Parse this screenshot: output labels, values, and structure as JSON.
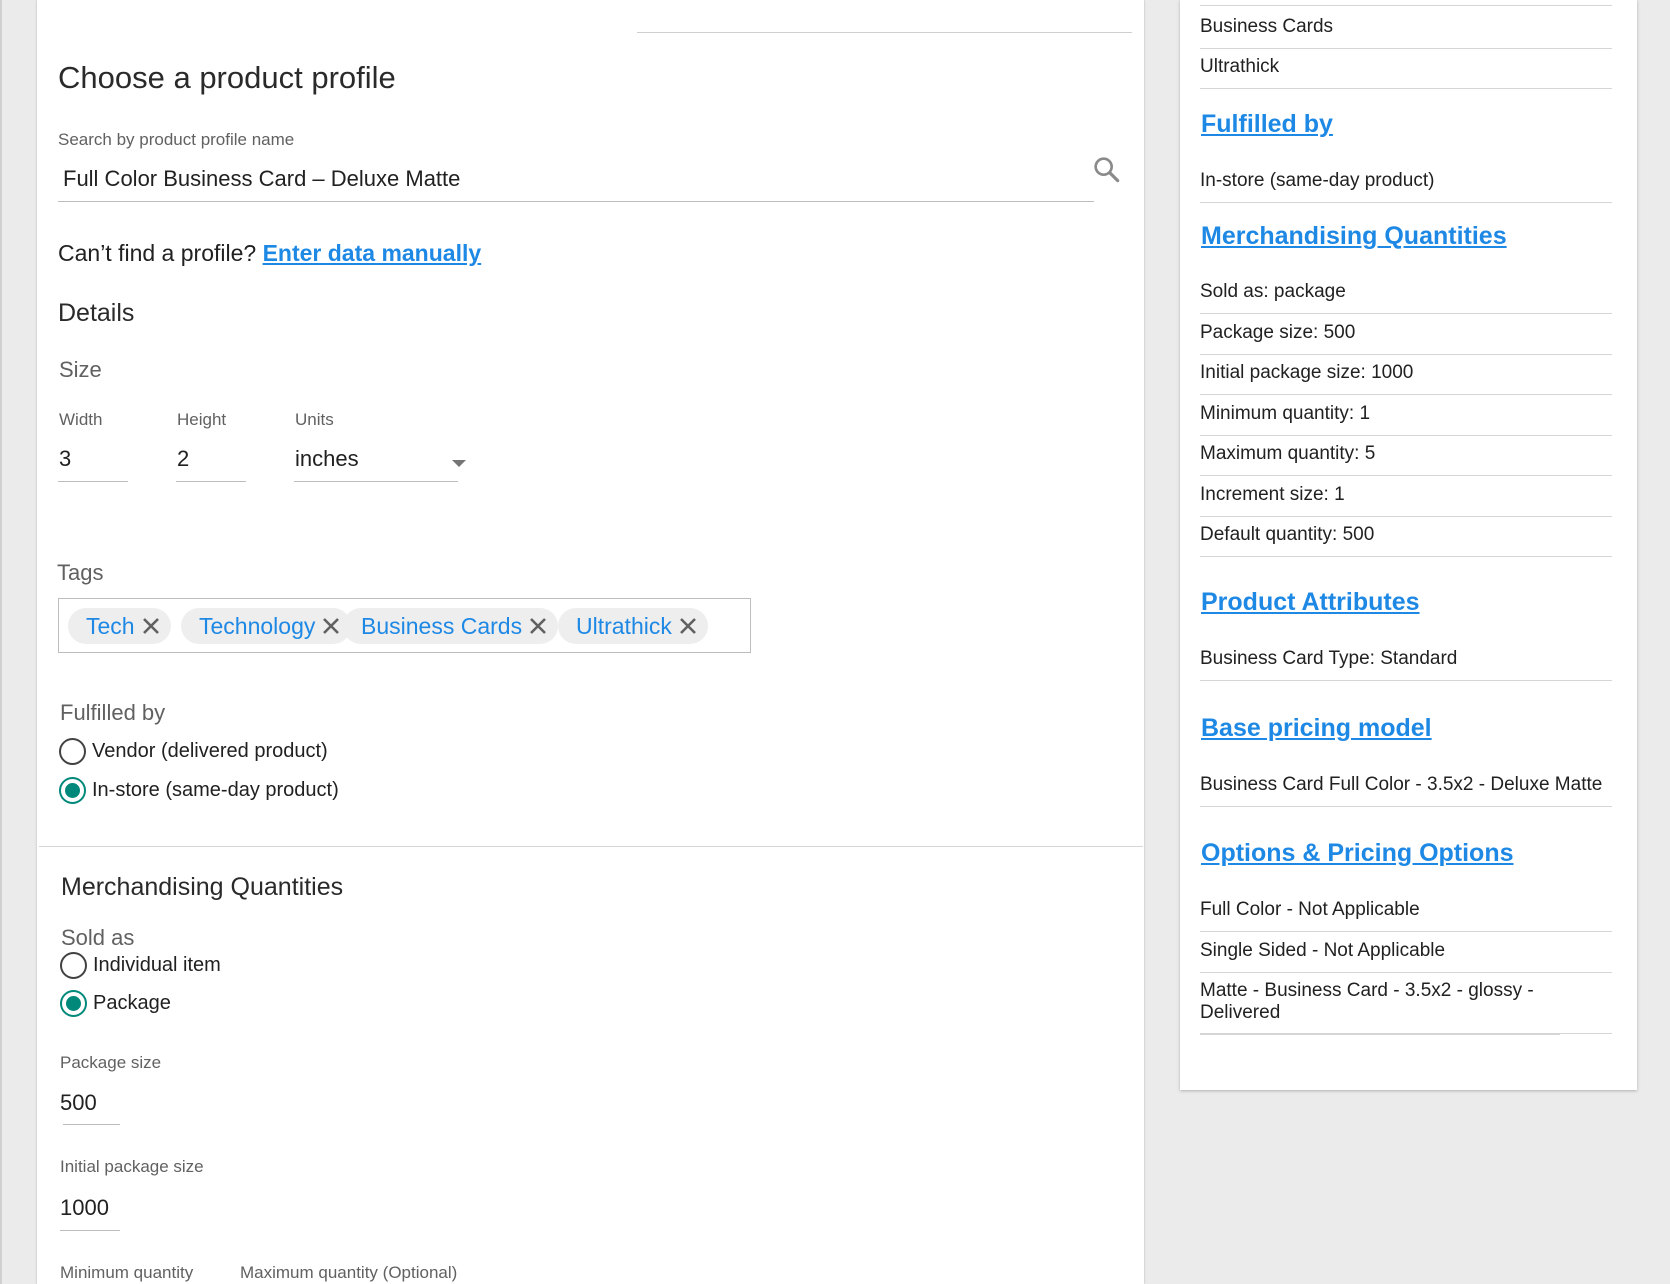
{
  "main": {
    "heading": "Choose a product profile",
    "search": {
      "label": "Search by product profile name",
      "value": "Full Color Business Card – Deluxe Matte",
      "icon": "search-icon"
    },
    "cant_find": {
      "text": "Can’t find a profile?",
      "link": "Enter data manually"
    },
    "details": {
      "title": "Details",
      "size_label": "Size",
      "width": {
        "label": "Width",
        "value": "3"
      },
      "height": {
        "label": "Height",
        "value": "2"
      },
      "units": {
        "label": "Units",
        "value": "inches"
      }
    },
    "tags": {
      "label": "Tags",
      "items": [
        "Tech",
        "Technology",
        "Business Cards",
        "Ultrathick"
      ]
    },
    "fulfilled": {
      "label": "Fulfilled by",
      "options": [
        {
          "label": "Vendor (delivered product)",
          "selected": false
        },
        {
          "label": "In-store (same-day product)",
          "selected": true
        }
      ]
    },
    "merch": {
      "title": "Merchandising Quantities",
      "sold_as_label": "Sold as",
      "options": [
        {
          "label": "Individual item",
          "selected": false
        },
        {
          "label": "Package",
          "selected": true
        }
      ],
      "package_size": {
        "label": "Package size",
        "value": "500"
      },
      "initial_package_size": {
        "label": "Initial package size",
        "value": "1000"
      },
      "minimum_quantity_label": "Minimum quantity",
      "maximum_quantity_label": "Maximum quantity (Optional)"
    }
  },
  "summary": {
    "tags_rows": [
      "Business Cards",
      "Ultrathick"
    ],
    "fulfilled_head": "Fulfilled by",
    "fulfilled_rows": [
      "In-store (same-day product)"
    ],
    "merch_head": "Merchandising Quantities",
    "merch_rows": [
      "Sold as: package",
      "Package size: 500",
      "Initial package size: 1000",
      "Minimum quantity: 1",
      "Maximum quantity: 5",
      "Increment size: 1",
      "Default quantity: 500"
    ],
    "attributes_head": "Product Attributes",
    "attributes_rows": [
      "Business Card Type: Standard"
    ],
    "pricing_head": "Base pricing model",
    "pricing_rows": [
      "Business Card Full Color - 3.5x2 - Deluxe Matte"
    ],
    "options_head": "Options & Pricing Options",
    "options_rows": [
      "Full Color - Not Applicable",
      "Single Sided - Not Applicable",
      "Matte - Business Card - 3.5x2 - glossy - Delivered"
    ]
  },
  "colors": {
    "link": "#1e88e5",
    "radio_selected": "#00897b",
    "background": "#ebebeb"
  }
}
